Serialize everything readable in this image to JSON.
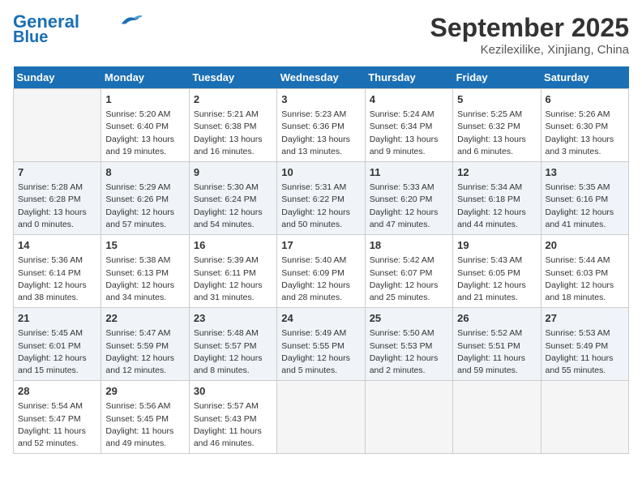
{
  "logo": {
    "line1": "General",
    "line2": "Blue"
  },
  "title": "September 2025",
  "subtitle": "Kezilexilike, Xinjiang, China",
  "headers": [
    "Sunday",
    "Monday",
    "Tuesday",
    "Wednesday",
    "Thursday",
    "Friday",
    "Saturday"
  ],
  "weeks": [
    [
      {
        "day": "",
        "sunrise": "",
        "sunset": "",
        "daylight": ""
      },
      {
        "day": "1",
        "sunrise": "5:20 AM",
        "sunset": "6:40 PM",
        "daylight": "13 hours and 19 minutes."
      },
      {
        "day": "2",
        "sunrise": "5:21 AM",
        "sunset": "6:38 PM",
        "daylight": "13 hours and 16 minutes."
      },
      {
        "day": "3",
        "sunrise": "5:23 AM",
        "sunset": "6:36 PM",
        "daylight": "13 hours and 13 minutes."
      },
      {
        "day": "4",
        "sunrise": "5:24 AM",
        "sunset": "6:34 PM",
        "daylight": "13 hours and 9 minutes."
      },
      {
        "day": "5",
        "sunrise": "5:25 AM",
        "sunset": "6:32 PM",
        "daylight": "13 hours and 6 minutes."
      },
      {
        "day": "6",
        "sunrise": "5:26 AM",
        "sunset": "6:30 PM",
        "daylight": "13 hours and 3 minutes."
      }
    ],
    [
      {
        "day": "7",
        "sunrise": "5:28 AM",
        "sunset": "6:28 PM",
        "daylight": "13 hours and 0 minutes."
      },
      {
        "day": "8",
        "sunrise": "5:29 AM",
        "sunset": "6:26 PM",
        "daylight": "12 hours and 57 minutes."
      },
      {
        "day": "9",
        "sunrise": "5:30 AM",
        "sunset": "6:24 PM",
        "daylight": "12 hours and 54 minutes."
      },
      {
        "day": "10",
        "sunrise": "5:31 AM",
        "sunset": "6:22 PM",
        "daylight": "12 hours and 50 minutes."
      },
      {
        "day": "11",
        "sunrise": "5:33 AM",
        "sunset": "6:20 PM",
        "daylight": "12 hours and 47 minutes."
      },
      {
        "day": "12",
        "sunrise": "5:34 AM",
        "sunset": "6:18 PM",
        "daylight": "12 hours and 44 minutes."
      },
      {
        "day": "13",
        "sunrise": "5:35 AM",
        "sunset": "6:16 PM",
        "daylight": "12 hours and 41 minutes."
      }
    ],
    [
      {
        "day": "14",
        "sunrise": "5:36 AM",
        "sunset": "6:14 PM",
        "daylight": "12 hours and 38 minutes."
      },
      {
        "day": "15",
        "sunrise": "5:38 AM",
        "sunset": "6:13 PM",
        "daylight": "12 hours and 34 minutes."
      },
      {
        "day": "16",
        "sunrise": "5:39 AM",
        "sunset": "6:11 PM",
        "daylight": "12 hours and 31 minutes."
      },
      {
        "day": "17",
        "sunrise": "5:40 AM",
        "sunset": "6:09 PM",
        "daylight": "12 hours and 28 minutes."
      },
      {
        "day": "18",
        "sunrise": "5:42 AM",
        "sunset": "6:07 PM",
        "daylight": "12 hours and 25 minutes."
      },
      {
        "day": "19",
        "sunrise": "5:43 AM",
        "sunset": "6:05 PM",
        "daylight": "12 hours and 21 minutes."
      },
      {
        "day": "20",
        "sunrise": "5:44 AM",
        "sunset": "6:03 PM",
        "daylight": "12 hours and 18 minutes."
      }
    ],
    [
      {
        "day": "21",
        "sunrise": "5:45 AM",
        "sunset": "6:01 PM",
        "daylight": "12 hours and 15 minutes."
      },
      {
        "day": "22",
        "sunrise": "5:47 AM",
        "sunset": "5:59 PM",
        "daylight": "12 hours and 12 minutes."
      },
      {
        "day": "23",
        "sunrise": "5:48 AM",
        "sunset": "5:57 PM",
        "daylight": "12 hours and 8 minutes."
      },
      {
        "day": "24",
        "sunrise": "5:49 AM",
        "sunset": "5:55 PM",
        "daylight": "12 hours and 5 minutes."
      },
      {
        "day": "25",
        "sunrise": "5:50 AM",
        "sunset": "5:53 PM",
        "daylight": "12 hours and 2 minutes."
      },
      {
        "day": "26",
        "sunrise": "5:52 AM",
        "sunset": "5:51 PM",
        "daylight": "11 hours and 59 minutes."
      },
      {
        "day": "27",
        "sunrise": "5:53 AM",
        "sunset": "5:49 PM",
        "daylight": "11 hours and 55 minutes."
      }
    ],
    [
      {
        "day": "28",
        "sunrise": "5:54 AM",
        "sunset": "5:47 PM",
        "daylight": "11 hours and 52 minutes."
      },
      {
        "day": "29",
        "sunrise": "5:56 AM",
        "sunset": "5:45 PM",
        "daylight": "11 hours and 49 minutes."
      },
      {
        "day": "30",
        "sunrise": "5:57 AM",
        "sunset": "5:43 PM",
        "daylight": "11 hours and 46 minutes."
      },
      {
        "day": "",
        "sunrise": "",
        "sunset": "",
        "daylight": ""
      },
      {
        "day": "",
        "sunrise": "",
        "sunset": "",
        "daylight": ""
      },
      {
        "day": "",
        "sunrise": "",
        "sunset": "",
        "daylight": ""
      },
      {
        "day": "",
        "sunrise": "",
        "sunset": "",
        "daylight": ""
      }
    ]
  ],
  "labels": {
    "sunrise_prefix": "Sunrise: ",
    "sunset_prefix": "Sunset: ",
    "daylight_prefix": "Daylight: "
  }
}
